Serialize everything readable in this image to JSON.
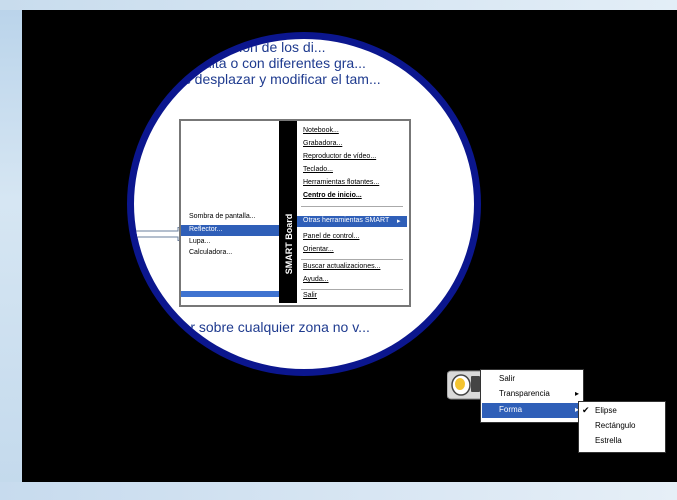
{
  "spot_text": {
    "line1": "ición de los di...",
    "line2": "ulta o con diferentes gra...",
    "line3": "os desplazar y modificar el tam...",
    "line4": "trar sobre cualquier zona no v..."
  },
  "submenu_left": {
    "items": [
      "Sombra de pantalla...",
      "Reflector...",
      "Lupa...",
      "Calculadora..."
    ]
  },
  "brand_text": "SMART Board",
  "main_menu": {
    "items": [
      "Notebook...",
      "Grabadora...",
      "Reproductor de vídeo...",
      "Teclado...",
      "Herramientas flotantes...",
      "Centro de inicio...",
      "Otras herramientas SMART",
      "Panel de control...",
      "Orientar...",
      "Buscar actualizaciones...",
      "Ayuda...",
      "Salir"
    ],
    "arrow": "▸"
  },
  "context_menu": {
    "items": [
      "Salir",
      "Transparencia",
      "Forma"
    ],
    "arrow": "▸"
  },
  "shape_submenu": {
    "check": "✔",
    "items": [
      "Elipse",
      "Rectángulo",
      "Estrella"
    ]
  }
}
